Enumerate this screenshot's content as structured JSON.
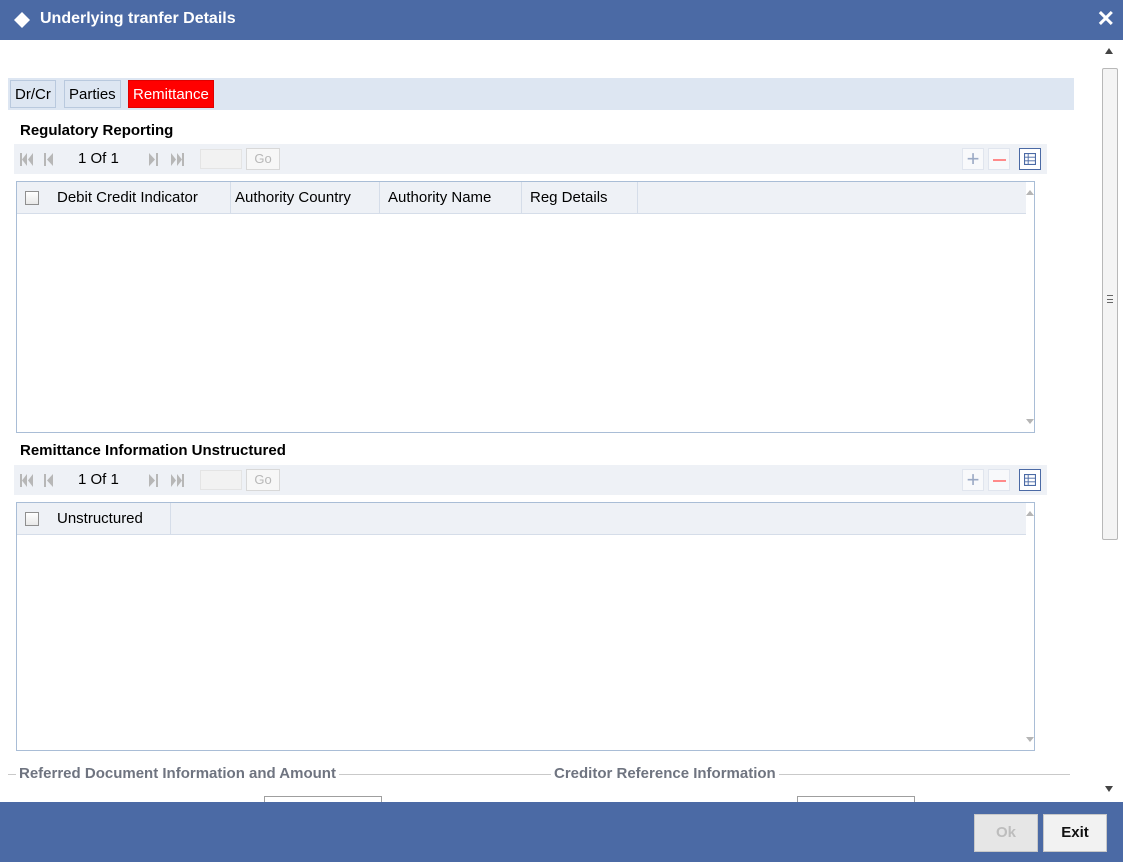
{
  "window": {
    "title": "Underlying tranfer Details",
    "close_label": "✕"
  },
  "tabs": [
    {
      "label": "Dr/Cr",
      "active": false
    },
    {
      "label": "Parties",
      "active": false
    },
    {
      "label": "Remittance",
      "active": true
    }
  ],
  "regulatory": {
    "title": "Regulatory Reporting",
    "pager": {
      "text": "1 Of 1",
      "go_label": "Go",
      "page_input": ""
    },
    "columns": [
      "Debit Credit Indicator",
      "Authority Country",
      "Authority Name",
      "Reg Details"
    ]
  },
  "remittance_unstructured": {
    "title": "Remittance Information Unstructured",
    "pager": {
      "text": "1 Of 1",
      "go_label": "Go",
      "page_input": ""
    },
    "columns": [
      "Unstructured"
    ]
  },
  "fieldsets": {
    "referred_document": "Referred Document Information and Amount",
    "creditor_reference": "Creditor Reference Information"
  },
  "toolbar": {
    "add_symbol": "+"
  },
  "footer": {
    "ok_label": "Ok",
    "exit_label": "Exit"
  },
  "colors": {
    "titlebar": "#4b6aa5",
    "active_tab": "#ff0000",
    "tabbar": "#dde6f2",
    "grid_header": "#eef1f6"
  }
}
